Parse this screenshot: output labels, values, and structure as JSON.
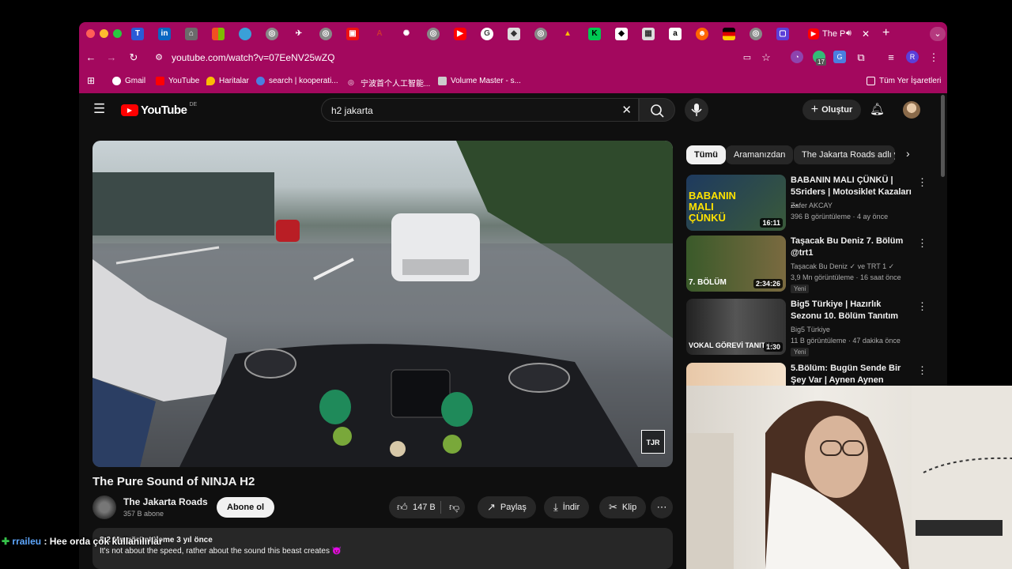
{
  "browser": {
    "active_tab_title": "The P",
    "url": "youtube.com/watch?v=07EeNV25wZQ",
    "ext_badge": "17",
    "profile_initial": "R",
    "bookmarks": [
      "Gmail",
      "YouTube",
      "Haritalar",
      "search | kooperati...",
      "宁波首个人工智能...",
      "Volume Master - s..."
    ],
    "all_bookmarks": "Tüm Yer İşaretleri",
    "colors": {
      "frame": "#a3085e"
    }
  },
  "youtube": {
    "logo_text": "YouTube",
    "region": "DE",
    "search_value": "h2 jakarta",
    "create_label": "Oluştur",
    "video": {
      "title": "The Pure Sound of NINJA H2",
      "channel": "The Jakarta Roads",
      "subscribers": "357 B abone",
      "subscribe_label": "Abone ol",
      "likes": "147 B",
      "share_label": "Paylaş",
      "download_label": "İndir",
      "clip_label": "Klip",
      "meta": "8,2 Mn görüntüleme  3 yıl önce",
      "description": "It's not about the speed, rather about the sound this beast creates 😈",
      "watermark": "TJR"
    },
    "chips": [
      "Tümü",
      "Aramanızdan",
      "The Jakarta Roads adlı y"
    ],
    "recommendations": [
      {
        "title": "BABANIN MALI ÇÜNKÜ | 5Sriders | Motosiklet Kazaları ...",
        "channel": "Zafer AKCAY",
        "meta": "396 B görüntüleme · 4 ay önce",
        "duration": "16:11",
        "thumb_text": "BABANIN MALI ÇÜNKÜ",
        "badge": ""
      },
      {
        "title": "Taşacak Bu Deniz 7. Bölüm @trt1",
        "channel": "Taşacak Bu Deniz ✓ ve TRT 1 ✓",
        "meta": "3,9 Mn görüntüleme · 16 saat önce",
        "duration": "2:34:26",
        "thumb_text": "7. BÖLÜM",
        "badge": "Yeni"
      },
      {
        "title": "Big5 Türkiye | Hazırlık Sezonu 10. Bölüm Tanıtım",
        "channel": "Big5 Türkiye",
        "meta": "11 B görüntüleme · 47 dakika önce",
        "duration": "1:30",
        "thumb_text": "VOKAL GÖREVİ TANITIM",
        "badge": "Yeni"
      },
      {
        "title": "5.Bölüm: Bugün Sende Bir Şey Var | Aynen Aynen",
        "channel": "",
        "meta": "",
        "duration": "",
        "thumb_text": "",
        "badge": ""
      }
    ]
  },
  "overlay": {
    "chat_user": "rraileu",
    "chat_message": ": Hee orda çok kullanılırlar"
  }
}
